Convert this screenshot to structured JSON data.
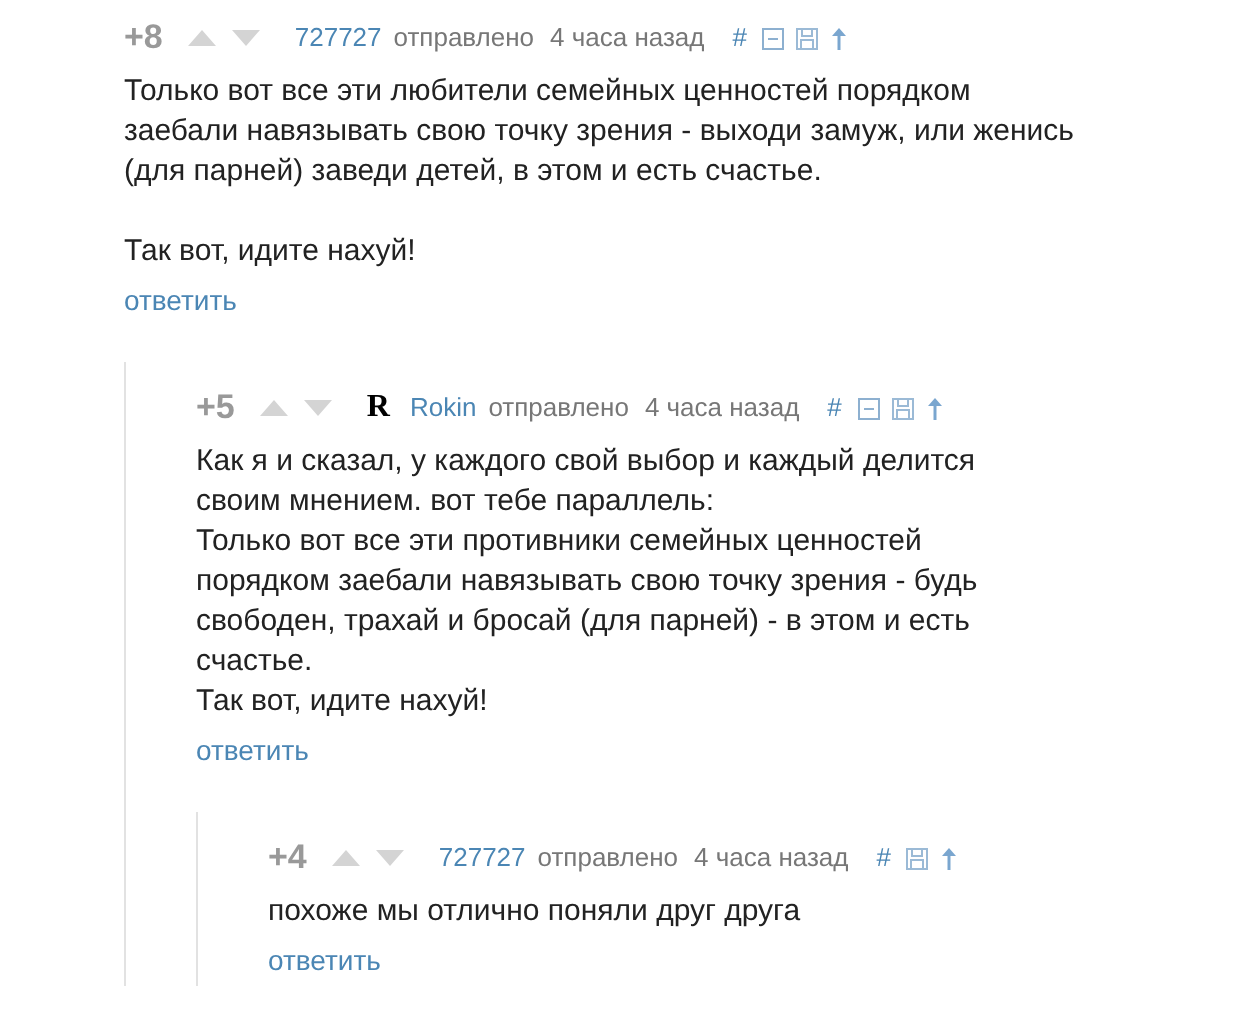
{
  "comments": [
    {
      "score": "+8",
      "author": "727727",
      "sent_label": "отправлено",
      "time": "4 часа назад",
      "hash": "#",
      "collapsible": true,
      "paragraphs_spaced": true,
      "paragraphs": [
        "Только вот все эти любители семейных ценностей порядком заебали навязывать свою точку зрения - выходи замуж, или женись (для парней) заведи детей, в этом и есть счастье.",
        "Так вот, идите нахуй!"
      ],
      "reply": "ответить",
      "children": [
        {
          "score": "+5",
          "avatar_text": "R",
          "author": "Rokin",
          "sent_label": "отправлено",
          "time": "4 часа назад",
          "hash": "#",
          "collapsible": true,
          "paragraphs_spaced": false,
          "paragraphs": [
            "Как я и сказал, у каждого свой выбор и каждый делится своим мнением. вот тебе параллель:",
            "Только вот все эти противники семейных ценностей порядком заебали навязывать свою точку зрения - будь свободен, трахай и бросай (для парней) - в этом и есть счастье.",
            "Так вот, идите нахуй!"
          ],
          "reply": "ответить",
          "children": [
            {
              "score": "+4",
              "author": "727727",
              "sent_label": "отправлено",
              "time": "4 часа назад",
              "hash": "#",
              "collapsible": false,
              "paragraphs": [
                "похоже мы отлично поняли друг друга"
              ],
              "reply": "ответить"
            }
          ]
        }
      ]
    }
  ]
}
